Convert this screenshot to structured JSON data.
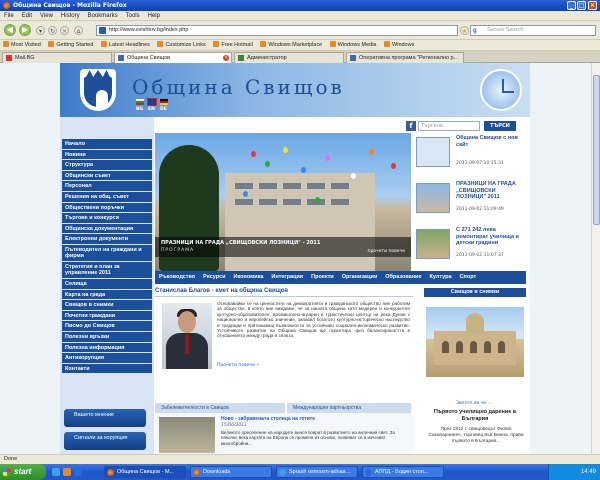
{
  "browser": {
    "window_title": "Община Свищов - Mozilla Firefox",
    "menu": [
      "File",
      "Edit",
      "View",
      "History",
      "Bookmarks",
      "Tools",
      "Help"
    ],
    "url": "http://www.svishtov.bg/index.php",
    "search_placeholder": "Secure Search",
    "bookmarks": [
      "Most Visited",
      "Getting Started",
      "Latest Headlines",
      "Customize Links",
      "Free Hotmail",
      "Windows Marketplace",
      "Windows Media",
      "Windows"
    ],
    "tabs": [
      "Mail.BG",
      "Община Свищов",
      "Администратор",
      "Оперативна програма \"Регионално р..."
    ],
    "status": "Done"
  },
  "site": {
    "title": "Община Свищов",
    "languages": [
      "BG",
      "EN",
      "DE"
    ],
    "search_placeholder": "Търсене...",
    "search_button": "ТЪРСИ",
    "menu": [
      "Начало",
      "Новини",
      "Структура",
      "Общински съвет",
      "Персонал",
      "Решения на общ. съвет",
      "Обществени поръчки",
      "Търгове и конкурси",
      "Общинска документация",
      "Електронни документи",
      "Пътеводител на граждани и фирми",
      "Стратегия и план за управление 2011",
      "Селища",
      "Карта на града",
      "Свищов в снимки",
      "Почетни граждани",
      "Писмо до Свищов",
      "Полезни връзки",
      "Полезна информация",
      "Антикорупция",
      "Контакти"
    ],
    "side_buttons": [
      "Вашето мнение",
      "Сигнали за корупция"
    ],
    "hero": {
      "caption": "ПРАЗНИЦИ НА ГРАДА „СВИЩОВСКИ ЛОЗНИЦИ\" - 2011",
      "sub": "ПРОГРАМА",
      "more": "прочети повече"
    },
    "news": [
      {
        "title": "Община Свищов с нов сайт",
        "date": "2011-09-07 10:15:31"
      },
      {
        "title": "ПРАЗНИЦИ НА ГРАДА „СВИЩОВСКИ ЛОЗНИЦИ\" 2011",
        "date": "2011-09-02 11:09:49"
      },
      {
        "title": "С 271 242 лева ремонтират училища и детски градини",
        "date": "2011-09-02 11:07:37"
      }
    ],
    "topics": [
      "Ръководство",
      "Ресурси",
      "Икономика",
      "Интеграция",
      "Проекти",
      "Организации",
      "Образование",
      "Култура",
      "Спорт"
    ],
    "mayor": {
      "heading": "Станислав Благов - кмет на община Свищов",
      "text": "Основавайки се на ценностите на демократията и гражданското общество ние работим за общество, в което ние виждаме, че за нашата община като модерен и конкурентен културно-образователен, промишлено-аграрен и туристически център на река Дунав с национално и европейско значение, запазил богатото културно-историческо наследство и традиции и притежаващ възможности за устойчиво социално-икономическо развитие. Устойчивото развитие на Община Свищов ще гарантира чрез балансираността в отношенията между града и селата.",
      "more": "Прочети повече »"
    },
    "pictures": {
      "heading": "Свищов в снимки",
      "link": "Звезте ли че ..."
    },
    "bottom_tabs": [
      "Забележителности в Свищов",
      "Международни партньорства"
    ],
    "sight": {
      "title": "Ново - забравената столица на готите",
      "date": "15/06/2011",
      "text": "Великото преселение на народите внася поврат в развитието на античния свят. За няколко века картата на Европа се променя из основи, появяват се и изчезват многобройни..."
    },
    "right_news": {
      "title": "Първото училищно дарение в България",
      "text": "През 1812 г. свищовецът Филип Сакапарнинеч, търговец във Виена, прави първото в България..."
    }
  },
  "taskbar": {
    "start": "start",
    "buttons": [
      "Община Свищов - M...",
      "Downloads",
      "Sprash osmosm-adnas...",
      "АППД - Бодин стоп..."
    ],
    "time": "14:49"
  }
}
